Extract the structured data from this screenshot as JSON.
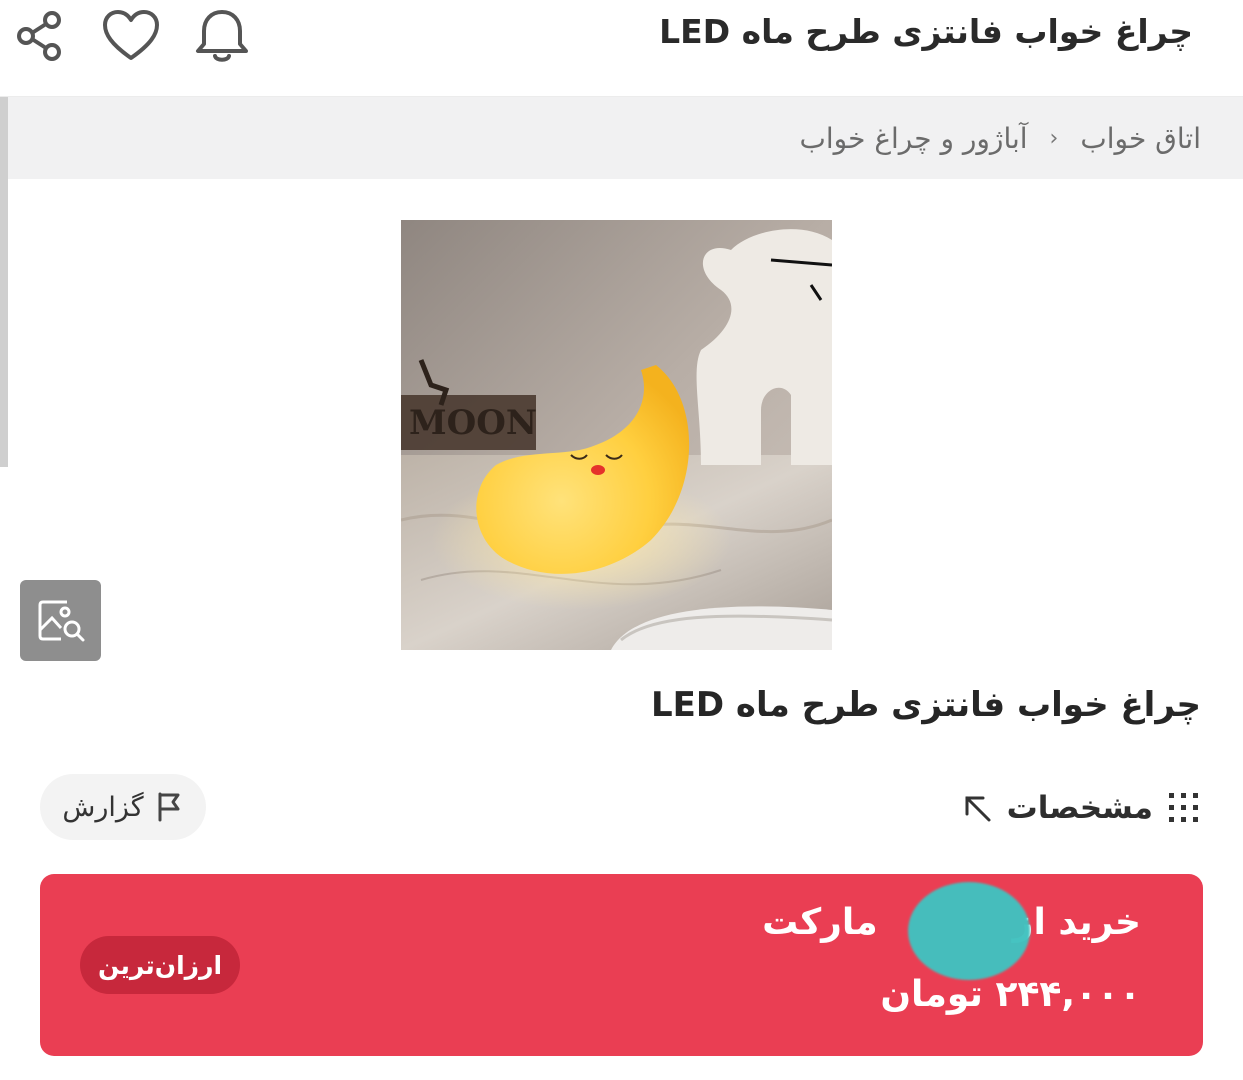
{
  "header": {
    "title": "چراغ خواب فانتزی طرح ماه LED",
    "icons": [
      "share-icon",
      "heart-icon",
      "bell-icon"
    ]
  },
  "breadcrumb": {
    "items": [
      "اتاق خواب",
      "آباژور و چراغ خواب"
    ],
    "separator": "‹"
  },
  "product": {
    "title": "چراغ خواب فانتزی طرح ماه LED",
    "image_text": "MOON",
    "specs_label": "مشخصات",
    "report_label": "گزارش"
  },
  "buy_box": {
    "line1_prefix": "خرید از",
    "line1_suffix": "مارکت",
    "price": "۲۴۴,۰۰۰ تومان",
    "badge": "ارزان‌ترین",
    "accent_color": "#ea3e53"
  }
}
